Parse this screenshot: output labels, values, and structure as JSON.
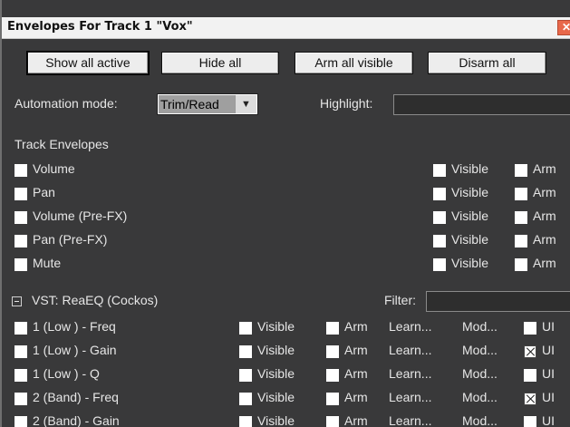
{
  "window": {
    "title": "Envelopes For Track 1 \"Vox\"",
    "close_glyph": "✕"
  },
  "toolbar": {
    "show_all_active": "Show all active",
    "hide_all": "Hide all",
    "arm_all_visible": "Arm all visible",
    "disarm_all": "Disarm all"
  },
  "automation": {
    "label": "Automation mode:",
    "selected": "Trim/Read",
    "arrow_glyph": "▼"
  },
  "highlight": {
    "label": "Highlight:",
    "value": ""
  },
  "track_envelopes": {
    "heading": "Track Envelopes",
    "visible_label": "Visible",
    "arm_label": "Arm",
    "items": [
      {
        "label": "Volume"
      },
      {
        "label": "Pan"
      },
      {
        "label": "Volume (Pre-FX)"
      },
      {
        "label": "Pan (Pre-FX)"
      },
      {
        "label": "Mute"
      }
    ]
  },
  "plugin": {
    "collapse_glyph": "⊟",
    "name": "VST: ReaEQ (Cockos)",
    "filter_label": "Filter:",
    "filter_value": "",
    "visible_label": "Visible",
    "arm_label": "Arm",
    "learn_label": "Learn...",
    "mod_label": "Mod...",
    "ui_label": "UI",
    "params": [
      {
        "label": "1 (Low ) - Freq",
        "ui_checked": false
      },
      {
        "label": "1 (Low ) - Gain",
        "ui_checked": true
      },
      {
        "label": "1 (Low ) - Q",
        "ui_checked": false
      },
      {
        "label": "2 (Band) - Freq",
        "ui_checked": true
      },
      {
        "label": "2 (Band) - Gain",
        "ui_checked": false
      }
    ]
  },
  "colors": {
    "background": "#39393a",
    "text": "#e6e6e6",
    "title_bar": "#f2f2f2",
    "close": "#e8684a"
  }
}
